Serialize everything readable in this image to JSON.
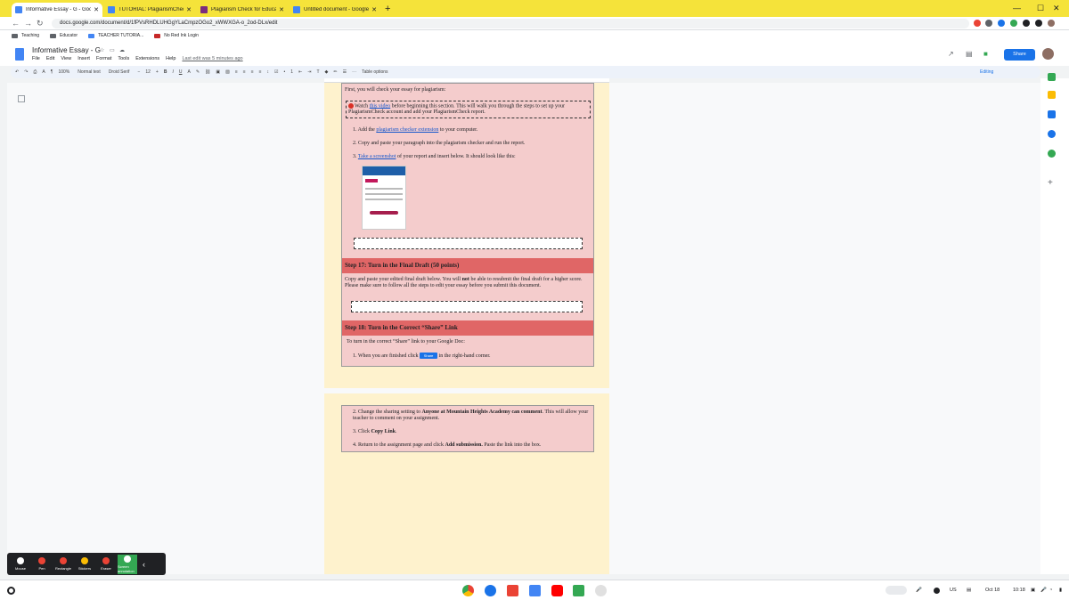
{
  "browser": {
    "tabs": [
      {
        "label": "Informative Essay - G - Google D",
        "active": true,
        "color": "#4285f4"
      },
      {
        "label": "TUTORIAL: PlagiarismCheck.org",
        "active": false,
        "color": "#4285f4"
      },
      {
        "label": "Plagiarism Check for Educators",
        "active": false,
        "color": "#7b2d7e"
      },
      {
        "label": "Untitled document - Google Docs",
        "active": false,
        "color": "#4285f4"
      }
    ],
    "new_tab": "+",
    "url": "docs.google.com/document/d/1fPVsRHDLUHGgYLaCmpzOGo2_xWWXGA-o_2od-DLx/edit",
    "bookmarks": [
      "Teaching",
      "Educator",
      "TEACHER TUTORIA...",
      "No Red Ink Login"
    ]
  },
  "doc": {
    "title": "Informative Essay - G",
    "menu": [
      "File",
      "Edit",
      "View",
      "Insert",
      "Format",
      "Tools",
      "Extensions",
      "Help"
    ],
    "last_edit": "Last edit was 5 minutes ago",
    "share_label": "Share",
    "editing_mode": "Editing",
    "toolbar": {
      "zoom": "100%",
      "style": "Normal text",
      "font": "Droid Serif",
      "size": "12",
      "table_options": "Table options"
    }
  },
  "content": {
    "intro": "First, you will check your essay for plagiarism:",
    "note_pre": "Watch ",
    "note_link": "this video",
    "note_post": " before beginning this section. This will walk you through the steps to set up your PlagiarismCheck account and add your PlagiarismCheck report.",
    "steps16": {
      "s1_pre": "1.  Add the ",
      "s1_link": "plagiarism checker extension",
      "s1_post": " to your computer.",
      "s2": "2.  Copy and paste your paragraph into the plagiarism checker and run the report.",
      "s3_pre": "3.  ",
      "s3_link": "Take a screenshot",
      "s3_post": " of your report and insert below. It should look like this:"
    },
    "step17": {
      "heading": "Step 17:  Turn in the Final Draft (50 points)",
      "body_pre": "Copy and paste your edited final draft below. You will ",
      "body_bold": "not",
      "body_post": " be able to resubmit the final draft for a higher score. Please make sure to follow all the steps to edit your essay before you submit this document."
    },
    "step18": {
      "heading": "Step 18: Turn in the Correct “Share” Link",
      "intro": "To turn in the correct “Share” link to your Google Doc:",
      "s1_pre": "1.  When you are finished click ",
      "s1_chip": "Share",
      "s1_post": " in the right-hand corner.",
      "s2_pre": "2.  Change the sharing setting to ",
      "s2_bold": "Anyone at Mountain Heights Academy can comment",
      "s2_post": ". This will allow your teacher to comment on your assignment.",
      "s3_pre": "3.  Click ",
      "s3_bold": "Copy Link",
      "s3_post": ".",
      "s4_pre": "4.  Return to the assignment page and click ",
      "s4_bold": "Add submission.",
      "s4_post": " Paste the link into the box."
    }
  },
  "zoom_tools": [
    {
      "label": "Mouse",
      "color": "#ffffff"
    },
    {
      "label": "Pen",
      "color": "#ea4335"
    },
    {
      "label": "Rectangle",
      "color": "#ea4335"
    },
    {
      "label": "Stickers",
      "color": "#fbbc04"
    },
    {
      "label": "Eraser",
      "color": "#ea4335"
    },
    {
      "label": "Screen annotation",
      "color": "#34a853"
    }
  ],
  "tray": {
    "locale": "US",
    "date": "Oct 18",
    "time": "10:18"
  }
}
